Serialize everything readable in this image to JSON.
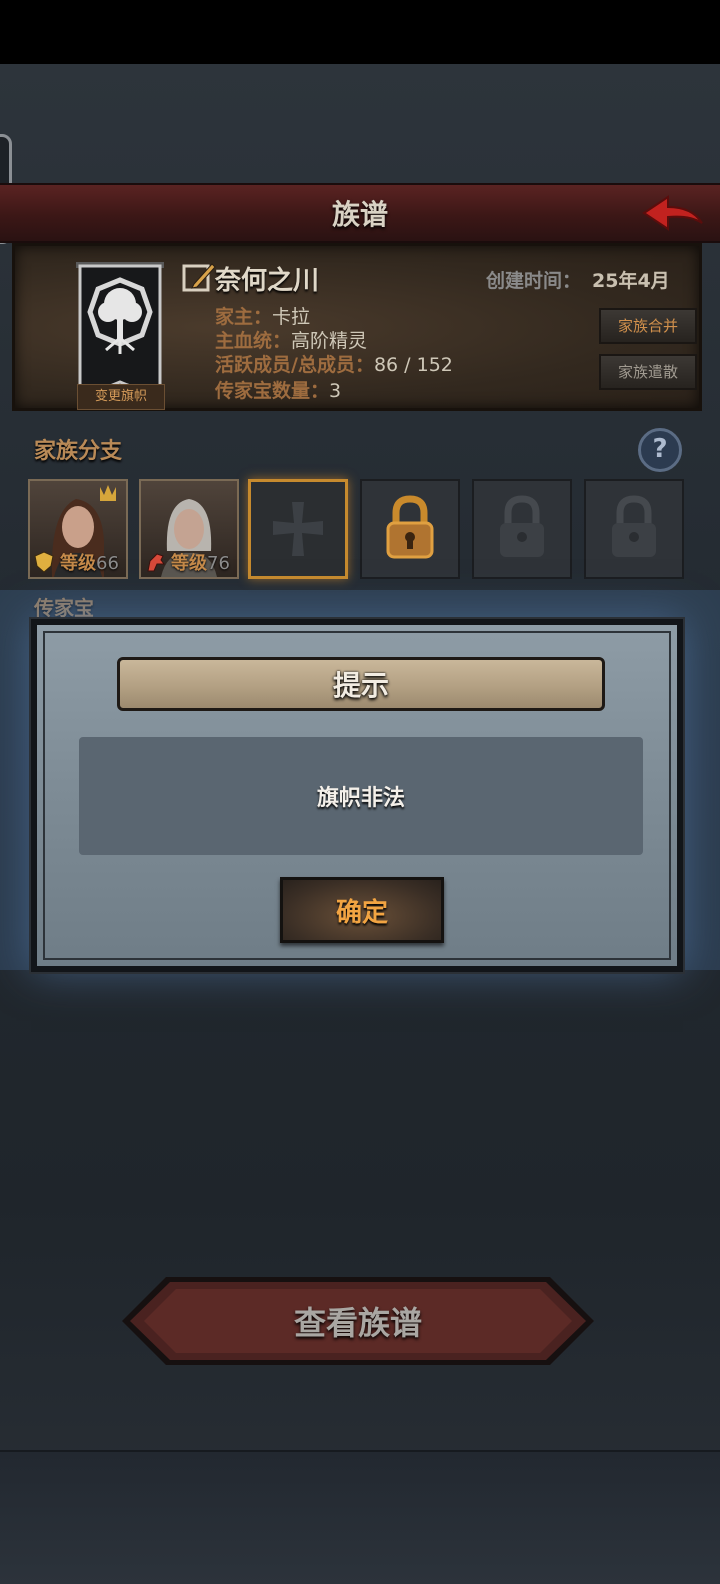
{
  "header": {
    "title": "族谱"
  },
  "family": {
    "banner_label": "变更旗帜",
    "name": "奈何之川",
    "created_label": "创建时间：",
    "created_value": "25年4月",
    "leader_label": "家主：",
    "leader_value": "卡拉",
    "bloodline_label": "主血统：",
    "bloodline_value": "高阶精灵",
    "members_label": "活跃成员/总成员：",
    "members_value": "86 / 152",
    "heirloom_label": "传家宝数量：",
    "heirloom_value": "3",
    "merge_button": "家族合并",
    "disband_button": "家族遣散"
  },
  "branches": {
    "title": "家族分支",
    "members": [
      {
        "level_prefix": "等级",
        "level": "66"
      },
      {
        "level_prefix": "等级",
        "level": "76"
      }
    ]
  },
  "heirloom_section": {
    "title": "传家宝"
  },
  "dialog": {
    "title": "提示",
    "message": "旗帜非法",
    "confirm": "确定"
  },
  "footer": {
    "view_tree_button": "查看族谱"
  },
  "colors": {
    "accent": "#c68a2e",
    "title_bar": "#4a1d1c",
    "modal_bg": "#7d8b95"
  }
}
